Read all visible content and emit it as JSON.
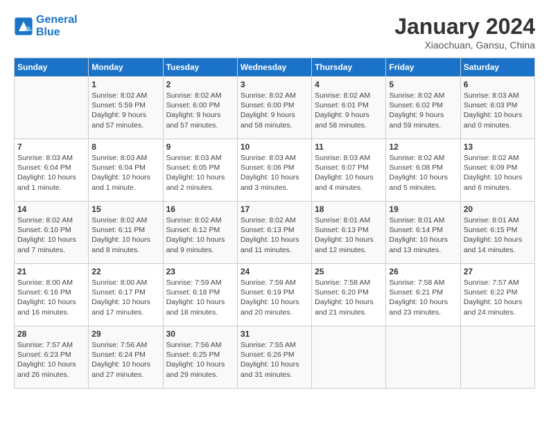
{
  "header": {
    "logo_line1": "General",
    "logo_line2": "Blue",
    "month": "January 2024",
    "location": "Xiaochuan, Gansu, China"
  },
  "days_of_week": [
    "Sunday",
    "Monday",
    "Tuesday",
    "Wednesday",
    "Thursday",
    "Friday",
    "Saturday"
  ],
  "weeks": [
    [
      {
        "date": "",
        "info": ""
      },
      {
        "date": "1",
        "info": "Sunrise: 8:02 AM\nSunset: 5:59 PM\nDaylight: 9 hours\nand 57 minutes."
      },
      {
        "date": "2",
        "info": "Sunrise: 8:02 AM\nSunset: 6:00 PM\nDaylight: 9 hours\nand 57 minutes."
      },
      {
        "date": "3",
        "info": "Sunrise: 8:02 AM\nSunset: 6:00 PM\nDaylight: 9 hours\nand 58 minutes."
      },
      {
        "date": "4",
        "info": "Sunrise: 8:02 AM\nSunset: 6:01 PM\nDaylight: 9 hours\nand 58 minutes."
      },
      {
        "date": "5",
        "info": "Sunrise: 8:02 AM\nSunset: 6:02 PM\nDaylight: 9 hours\nand 59 minutes."
      },
      {
        "date": "6",
        "info": "Sunrise: 8:03 AM\nSunset: 6:03 PM\nDaylight: 10 hours\nand 0 minutes."
      }
    ],
    [
      {
        "date": "7",
        "info": "Sunrise: 8:03 AM\nSunset: 6:04 PM\nDaylight: 10 hours\nand 1 minute."
      },
      {
        "date": "8",
        "info": "Sunrise: 8:03 AM\nSunset: 6:04 PM\nDaylight: 10 hours\nand 1 minute."
      },
      {
        "date": "9",
        "info": "Sunrise: 8:03 AM\nSunset: 6:05 PM\nDaylight: 10 hours\nand 2 minutes."
      },
      {
        "date": "10",
        "info": "Sunrise: 8:03 AM\nSunset: 6:06 PM\nDaylight: 10 hours\nand 3 minutes."
      },
      {
        "date": "11",
        "info": "Sunrise: 8:03 AM\nSunset: 6:07 PM\nDaylight: 10 hours\nand 4 minutes."
      },
      {
        "date": "12",
        "info": "Sunrise: 8:02 AM\nSunset: 6:08 PM\nDaylight: 10 hours\nand 5 minutes."
      },
      {
        "date": "13",
        "info": "Sunrise: 8:02 AM\nSunset: 6:09 PM\nDaylight: 10 hours\nand 6 minutes."
      }
    ],
    [
      {
        "date": "14",
        "info": "Sunrise: 8:02 AM\nSunset: 6:10 PM\nDaylight: 10 hours\nand 7 minutes."
      },
      {
        "date": "15",
        "info": "Sunrise: 8:02 AM\nSunset: 6:11 PM\nDaylight: 10 hours\nand 8 minutes."
      },
      {
        "date": "16",
        "info": "Sunrise: 8:02 AM\nSunset: 6:12 PM\nDaylight: 10 hours\nand 9 minutes."
      },
      {
        "date": "17",
        "info": "Sunrise: 8:02 AM\nSunset: 6:13 PM\nDaylight: 10 hours\nand 11 minutes."
      },
      {
        "date": "18",
        "info": "Sunrise: 8:01 AM\nSunset: 6:13 PM\nDaylight: 10 hours\nand 12 minutes."
      },
      {
        "date": "19",
        "info": "Sunrise: 8:01 AM\nSunset: 6:14 PM\nDaylight: 10 hours\nand 13 minutes."
      },
      {
        "date": "20",
        "info": "Sunrise: 8:01 AM\nSunset: 6:15 PM\nDaylight: 10 hours\nand 14 minutes."
      }
    ],
    [
      {
        "date": "21",
        "info": "Sunrise: 8:00 AM\nSunset: 6:16 PM\nDaylight: 10 hours\nand 16 minutes."
      },
      {
        "date": "22",
        "info": "Sunrise: 8:00 AM\nSunset: 6:17 PM\nDaylight: 10 hours\nand 17 minutes."
      },
      {
        "date": "23",
        "info": "Sunrise: 7:59 AM\nSunset: 6:18 PM\nDaylight: 10 hours\nand 18 minutes."
      },
      {
        "date": "24",
        "info": "Sunrise: 7:59 AM\nSunset: 6:19 PM\nDaylight: 10 hours\nand 20 minutes."
      },
      {
        "date": "25",
        "info": "Sunrise: 7:58 AM\nSunset: 6:20 PM\nDaylight: 10 hours\nand 21 minutes."
      },
      {
        "date": "26",
        "info": "Sunrise: 7:58 AM\nSunset: 6:21 PM\nDaylight: 10 hours\nand 23 minutes."
      },
      {
        "date": "27",
        "info": "Sunrise: 7:57 AM\nSunset: 6:22 PM\nDaylight: 10 hours\nand 24 minutes."
      }
    ],
    [
      {
        "date": "28",
        "info": "Sunrise: 7:57 AM\nSunset: 6:23 PM\nDaylight: 10 hours\nand 26 minutes."
      },
      {
        "date": "29",
        "info": "Sunrise: 7:56 AM\nSunset: 6:24 PM\nDaylight: 10 hours\nand 27 minutes."
      },
      {
        "date": "30",
        "info": "Sunrise: 7:56 AM\nSunset: 6:25 PM\nDaylight: 10 hours\nand 29 minutes."
      },
      {
        "date": "31",
        "info": "Sunrise: 7:55 AM\nSunset: 6:26 PM\nDaylight: 10 hours\nand 31 minutes."
      },
      {
        "date": "",
        "info": ""
      },
      {
        "date": "",
        "info": ""
      },
      {
        "date": "",
        "info": ""
      }
    ]
  ]
}
